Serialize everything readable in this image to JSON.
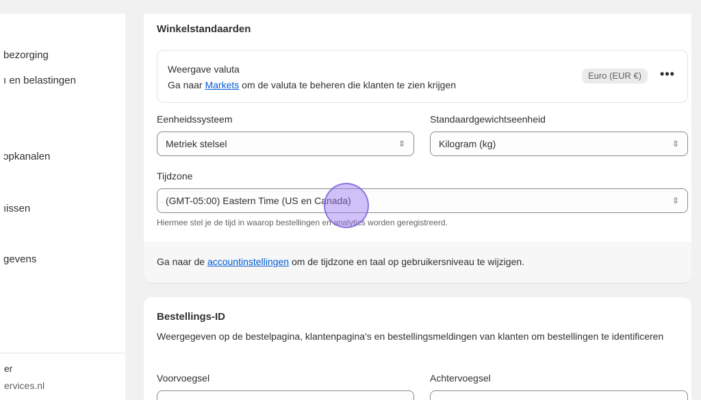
{
  "sidebar": {
    "items": [
      {
        "label": "bezorging"
      },
      {
        "label": "ı en belastingen"
      },
      {
        "label": "ɔpkanalen"
      },
      {
        "label": "ıissen"
      },
      {
        "label": "gevens"
      }
    ],
    "user": "er",
    "domain": "ervices.nl"
  },
  "store_defaults": {
    "title": "Winkelstandaarden",
    "currency": {
      "label": "Weergave valuta",
      "desc_prefix": "Ga naar",
      "desc_link": "Markets",
      "desc_suffix": "om de valuta te beheren die klanten te zien krijgen",
      "badge": "Euro (EUR €)",
      "more": "•••"
    },
    "unit_system": {
      "label": "Eenheidssysteem",
      "value": "Metriek stelsel"
    },
    "weight_unit": {
      "label": "Standaardgewichtseenheid",
      "value": "Kilogram (kg)"
    },
    "timezone": {
      "label": "Tijdzone",
      "value": "(GMT-05:00) Eastern Time (US en Canada)",
      "help": "Hiermee stel je de tijd in waarop bestellingen en analytics worden geregistreerd."
    },
    "footer": {
      "prefix": "Ga naar de",
      "link": "accountinstellingen",
      "suffix": "om de tijdzone en taal op gebruikersniveau te wijzigen."
    }
  },
  "order_id": {
    "title": "Bestellings-ID",
    "desc": "Weergegeven op de bestelpagina, klantenpagina's en bestellingsmeldingen van klanten om bestellingen te identificeren",
    "prefix_label": "Voorvoegsel",
    "suffix_label": "Achtervoegsel"
  },
  "icons": {
    "select": "chevron-up-down-icon",
    "more": "more-horizontal-icon"
  },
  "colors": {
    "link": "#005bd3",
    "cursor": "#9678f0"
  }
}
